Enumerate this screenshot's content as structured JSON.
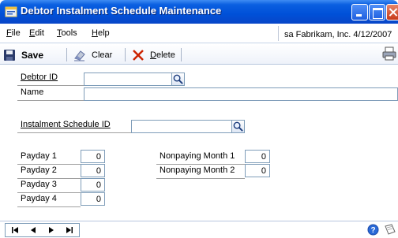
{
  "window": {
    "title": "Debtor Instalment Schedule Maintenance"
  },
  "menu": {
    "items": [
      {
        "label_u": "F",
        "label_rest": "ile"
      },
      {
        "label_u": "E",
        "label_rest": "dit"
      },
      {
        "label_u": "T",
        "label_rest": "ools"
      },
      {
        "label_u": "H",
        "label_rest": "elp"
      }
    ],
    "user_company_date": "sa  Fabrikam, Inc.  4/12/2007"
  },
  "toolbar": {
    "save_label": "Save",
    "clear_label": "Clear",
    "delete_label_u": "D",
    "delete_label_rest": "elete"
  },
  "form": {
    "debtor_id_label": "Debtor ID",
    "debtor_id_value": "",
    "name_label": "Name",
    "name_value": "",
    "schedule_id_label": "Instalment Schedule ID",
    "schedule_id_value": "",
    "paydays": [
      {
        "label": "Payday 1",
        "value": "0"
      },
      {
        "label": "Payday 2",
        "value": "0"
      },
      {
        "label": "Payday 3",
        "value": "0"
      },
      {
        "label": "Payday 4",
        "value": "0"
      }
    ],
    "nonpaying": [
      {
        "label": "Nonpaying Month 1",
        "value": "0"
      },
      {
        "label": "Nonpaying Month 2",
        "value": "0"
      }
    ]
  },
  "icons": {
    "app": "app-window-icon",
    "save": "floppy-disk-icon",
    "clear": "eraser-icon",
    "delete": "red-x-icon",
    "print": "printer-icon",
    "lookup": "magnifier-icon",
    "help": "help-icon",
    "note": "note-icon"
  },
  "colors": {
    "title_bar": "#0a5fe0",
    "delete_x": "#cc2200",
    "input_border": "#7f9db9"
  }
}
